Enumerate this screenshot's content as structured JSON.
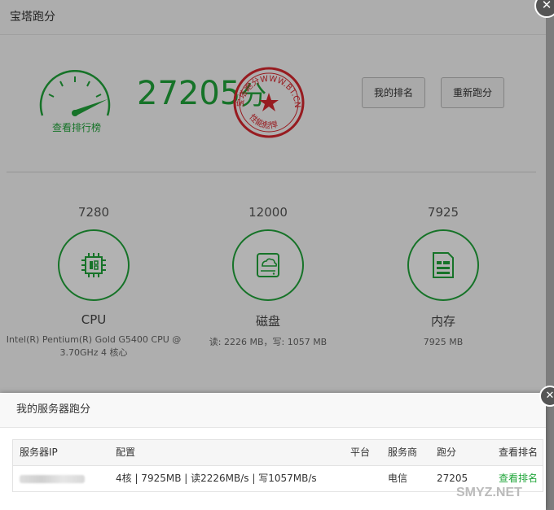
{
  "background_dialog": {
    "title": "宝塔跑分",
    "gauge_link": "查看排行榜",
    "score": "27205",
    "score_unit": "分",
    "stamp_text_top": "宝塔跑分WWW.BT.CN",
    "stamp_text_bottom": "性能彪悍",
    "buttons": {
      "my_rank": "我的排名",
      "rerun": "重新跑分"
    },
    "metrics": [
      {
        "value": "7280",
        "name": "CPU",
        "desc": "Intel(R) Pentium(R) Gold G5400 CPU @ 3.70GHz 4 核心",
        "icon": "cpu-chip-icon"
      },
      {
        "value": "12000",
        "name": "磁盘",
        "desc": "读: 2226 MB，写: 1057 MB",
        "icon": "disk-cloud-icon"
      },
      {
        "value": "7925",
        "name": "内存",
        "desc": "7925 MB",
        "icon": "memory-icon"
      }
    ]
  },
  "popup": {
    "title": "我的服务器跑分",
    "columns": [
      "服务器IP",
      "配置",
      "平台",
      "服务商",
      "跑分",
      "查看排名"
    ],
    "rows": [
      {
        "ip": "",
        "config": "4核 | 7925MB | 读2226MB/s | 写1057MB/s",
        "platform": "",
        "isp": "电信",
        "score": "27205",
        "rank_link": "查看排名"
      }
    ]
  },
  "watermark": "SMYZ.NET",
  "colors": {
    "accent": "#20a53a",
    "stamp": "#d9272e"
  },
  "icons": [
    "gauge-icon",
    "cpu-chip-icon",
    "disk-cloud-icon",
    "memory-icon",
    "close-icon"
  ]
}
